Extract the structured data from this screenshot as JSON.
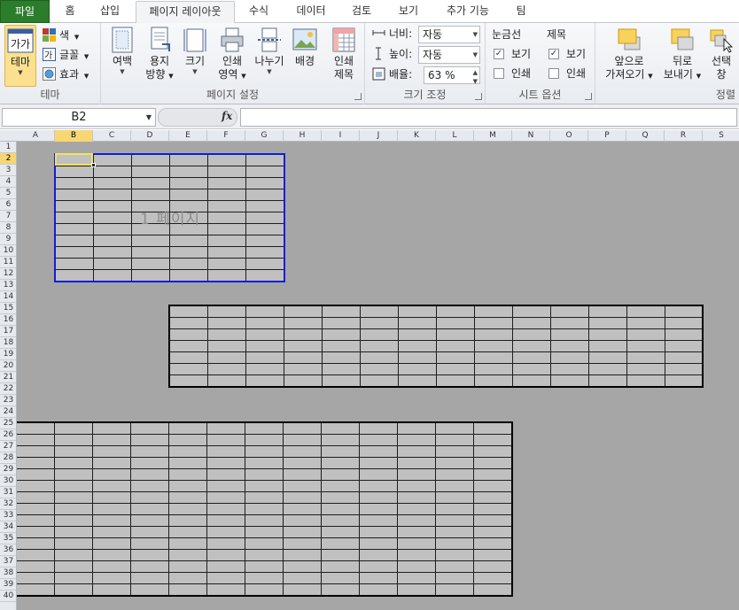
{
  "tabs": [
    {
      "label": "파일",
      "name": "tab-file"
    },
    {
      "label": "홈",
      "name": "tab-home"
    },
    {
      "label": "삽입",
      "name": "tab-insert"
    },
    {
      "label": "페이지 레이아웃",
      "name": "tab-page-layout"
    },
    {
      "label": "수식",
      "name": "tab-formulas"
    },
    {
      "label": "데이터",
      "name": "tab-data"
    },
    {
      "label": "검토",
      "name": "tab-review"
    },
    {
      "label": "보기",
      "name": "tab-view"
    },
    {
      "label": "추가 기능",
      "name": "tab-addins"
    },
    {
      "label": "팀",
      "name": "tab-team"
    }
  ],
  "ribbon": {
    "theme_group": {
      "label": "테마",
      "themes_button": "테마",
      "colors": "색",
      "fonts": "글꼴",
      "effects": "효과"
    },
    "page_setup_group": {
      "label": "페이지 설정",
      "margins_l1": "여백",
      "orientation_l1": "용지",
      "orientation_l2": "방향",
      "size_l1": "크기",
      "print_area_l1": "인쇄",
      "print_area_l2": "영역",
      "breaks_l1": "나누기",
      "background_l1": "배경",
      "print_titles_l1": "인쇄",
      "print_titles_l2": "제목"
    },
    "scale_group": {
      "label": "크기 조정",
      "width_label": "너비:",
      "width_value": "자동",
      "height_label": "높이:",
      "height_value": "자동",
      "scale_label": "배율:",
      "scale_value": "63 %"
    },
    "sheet_options_group": {
      "label": "시트 옵션",
      "gridlines_header": "눈금선",
      "headings_header": "제목",
      "gridlines_view": "보기",
      "gridlines_print": "인쇄",
      "headings_view": "보기",
      "headings_print": "인쇄",
      "gridlines_view_checked": true,
      "gridlines_print_checked": false,
      "headings_view_checked": true,
      "headings_print_checked": false
    },
    "arrange_group": {
      "label": "정렬",
      "bring_forward_l1": "앞으로",
      "bring_forward_l2": "가져오기",
      "send_backward_l1": "뒤로",
      "send_backward_l2": "보내기",
      "selection_pane_l1": "선택",
      "selection_pane_l2": "창"
    }
  },
  "formula_bar": {
    "name_box": "B2",
    "fx": "fx",
    "formula": ""
  },
  "columns": [
    "A",
    "B",
    "C",
    "D",
    "E",
    "F",
    "G",
    "H",
    "I",
    "J",
    "K",
    "L",
    "M",
    "N",
    "O",
    "P",
    "Q",
    "R",
    "S"
  ],
  "selected_column": "B",
  "selected_row": 2,
  "row_count": 40,
  "page_watermark": "1 페이지",
  "colors": {
    "file_tab": "#2b7c2b",
    "page1_border": "#0f1fd6",
    "active_cell": "#f2e35a",
    "sheet_background": "#a6a6a6",
    "print_area_fill": "#c0c0c0"
  }
}
